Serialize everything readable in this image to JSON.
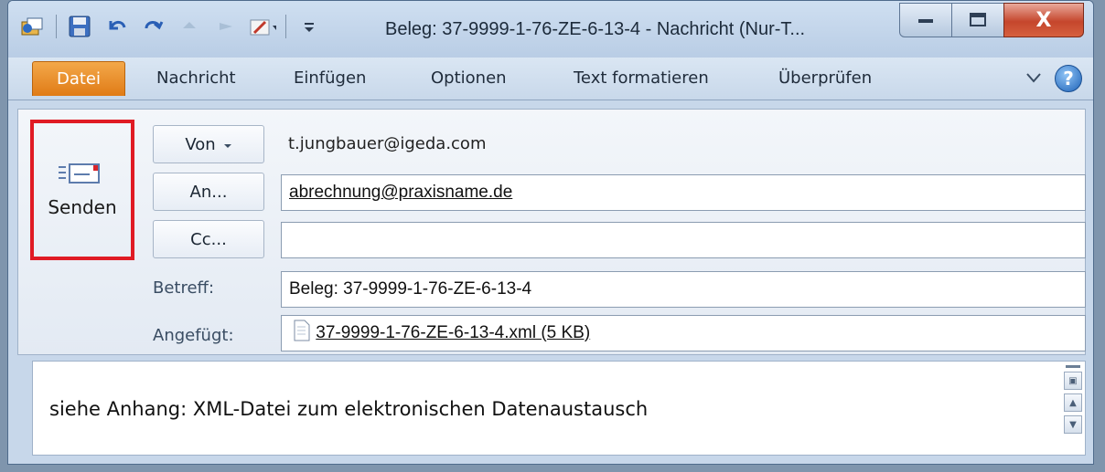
{
  "titlebar": {
    "title": "Beleg: 37-9999-1-76-ZE-6-13-4  - Nachricht (Nur-T...",
    "close_glyph": "X"
  },
  "ribbon": {
    "tabs": [
      "Datei",
      "Nachricht",
      "Einfügen",
      "Optionen",
      "Text formatieren",
      "Überprüfen"
    ],
    "help_glyph": "?",
    "file_tab_color": "#e07b16"
  },
  "header": {
    "send_label": "Senden",
    "from_label": "Von",
    "from_value": "t.jungbauer@igeda.com",
    "to_label": "An...",
    "to_value": "abrechnung@praxisname.de",
    "cc_label": "Cc...",
    "cc_value": "",
    "subject_label": "Betreff:",
    "subject_value": "Beleg: 37-9999-1-76-ZE-6-13-4",
    "attached_label": "Angefügt:",
    "attachment": "37-9999-1-76-ZE-6-13-4.xml (5 KB)",
    "highlight_color": "#e01b24"
  },
  "body": {
    "text": "siehe Anhang: XML-Datei zum elektronischen Datenaustausch"
  },
  "icons": [
    "outlook-icon",
    "save-icon",
    "undo-icon",
    "redo-icon",
    "previous-icon",
    "next-icon",
    "customize-icon",
    "quick-access-dropdown-icon",
    "minimize-icon",
    "maximize-icon",
    "close-icon",
    "collapse-ribbon-icon",
    "help-icon",
    "send-icon",
    "dropdown-arrow-icon",
    "attachment-file-icon",
    "scroll-up-icon",
    "scroll-down-icon"
  ]
}
